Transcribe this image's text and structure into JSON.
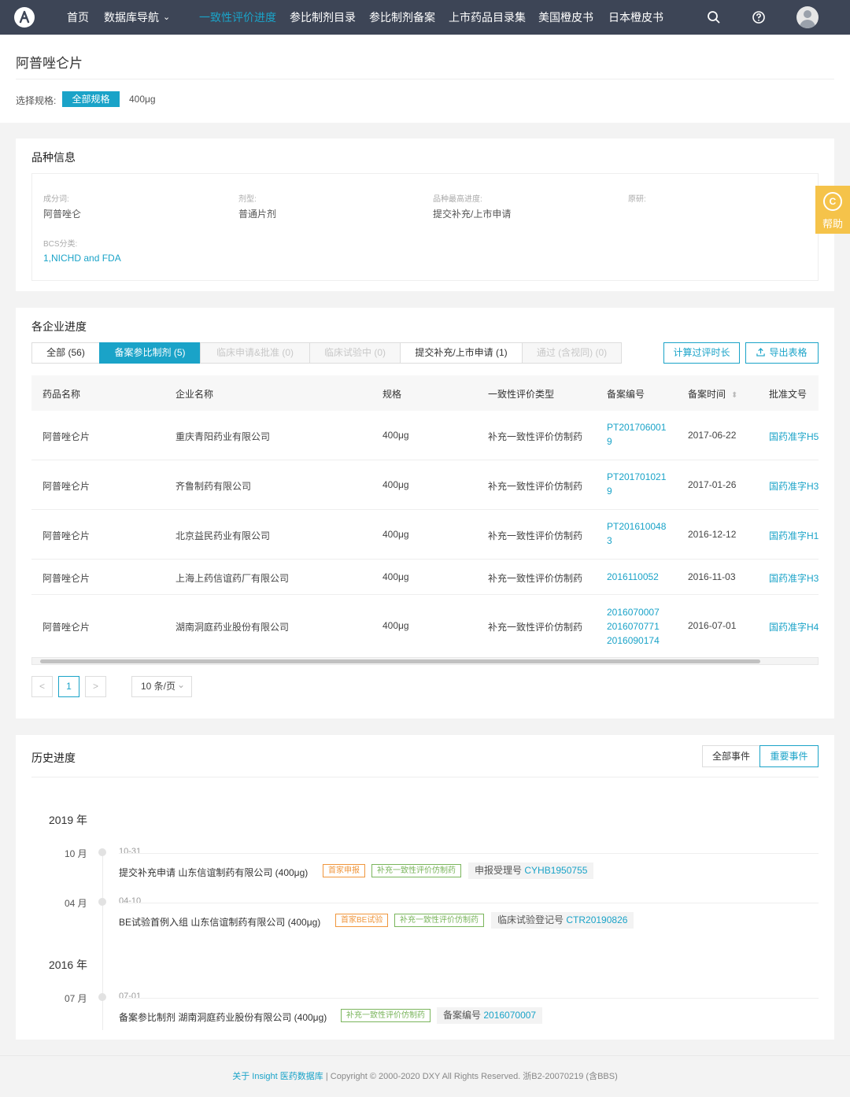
{
  "nav": {
    "items": [
      "首页",
      "数据库导航",
      "一致性评价进度",
      "参比制剂目录",
      "参比制剂备案",
      "上市药品目录集",
      "美国橙皮书",
      "日本橙皮书"
    ],
    "dropdown_caret": "⌄",
    "active_color": "#1aa3c8"
  },
  "page": {
    "title": "阿普唑仑片",
    "spec_label": "选择规格:",
    "spec_all": "全部规格",
    "spec_option": "400μg"
  },
  "variety": {
    "title": "品种信息",
    "fields": [
      {
        "label": "成分词:",
        "value": "阿普唑仑"
      },
      {
        "label": "剂型:",
        "value": "普通片剂"
      },
      {
        "label": "品种最高进度:",
        "value": "提交补充/上市申请"
      },
      {
        "label": "原研:",
        "value": ""
      },
      {
        "label": "BCS分类:",
        "value": "1,NICHD and FDA"
      }
    ]
  },
  "help": {
    "icon": "C",
    "label": "帮助"
  },
  "progress": {
    "title": "各企业进度",
    "tabs": [
      {
        "label": "全部 (56)",
        "state": "normal"
      },
      {
        "label": "备案参比制剂 (5)",
        "state": "active"
      },
      {
        "label": "临床申请&批准 (0)",
        "state": "disabled"
      },
      {
        "label": "临床试验中 (0)",
        "state": "disabled"
      },
      {
        "label": "提交补充/上市申请 (1)",
        "state": "normal"
      },
      {
        "label": "通过 (含视同) (0)",
        "state": "disabled"
      }
    ],
    "btn_calc": "计算过评时长",
    "btn_export": "导出表格",
    "columns": [
      "药品名称",
      "企业名称",
      "规格",
      "一致性评价类型",
      "备案编号",
      "备案时间",
      "批准文号"
    ],
    "sort_icon": "⬍",
    "rows": [
      {
        "drug": "阿普唑仑片",
        "company": "重庆青阳药业有限公司",
        "spec": "400μg",
        "type": "补充一致性评价仿制药",
        "records": [
          "PT201706001",
          "9"
        ],
        "date": "2017-06-22",
        "approval": "国药准字H5"
      },
      {
        "drug": "阿普唑仑片",
        "company": "齐鲁制药有限公司",
        "spec": "400μg",
        "type": "补充一致性评价仿制药",
        "records": [
          "PT201701021",
          "9"
        ],
        "date": "2017-01-26",
        "approval": "国药准字H3"
      },
      {
        "drug": "阿普唑仑片",
        "company": "北京益民药业有限公司",
        "spec": "400μg",
        "type": "补充一致性评价仿制药",
        "records": [
          "PT201610048",
          "3"
        ],
        "date": "2016-12-12",
        "approval": "国药准字H1"
      },
      {
        "drug": "阿普唑仑片",
        "company": "上海上药信谊药厂有限公司",
        "spec": "400μg",
        "type": "补充一致性评价仿制药",
        "records": [
          "2016110052"
        ],
        "date": "2016-11-03",
        "approval": "国药准字H3"
      },
      {
        "drug": "阿普唑仑片",
        "company": "湖南洞庭药业股份有限公司",
        "spec": "400μg",
        "type": "补充一致性评价仿制药",
        "records": [
          "2016070007",
          "2016070771",
          "2016090174"
        ],
        "date": "2016-07-01",
        "approval": "国药准字H4"
      }
    ],
    "pagination": {
      "prev": "<",
      "current": "1",
      "next": ">",
      "page_size": "10 条/页"
    }
  },
  "history": {
    "title": "历史进度",
    "btn_all": "全部事件",
    "btn_important": "重要事件",
    "groups": [
      {
        "year": "2019 年",
        "events": [
          {
            "month": "10 月",
            "date": "10-31",
            "text": "提交补充申请 山东信谊制药有限公司 (400μg)",
            "tags": [
              {
                "t": "首家申报",
                "c": "orange"
              },
              {
                "t": "补充一致性评价仿制药",
                "c": "green"
              }
            ],
            "reg_label": "申报受理号",
            "reg_num": "CYHB1950755"
          },
          {
            "month": "04 月",
            "date": "04-10",
            "text": "BE试验首例入组 山东信谊制药有限公司 (400μg)",
            "tags": [
              {
                "t": "首家BE试验",
                "c": "orange"
              },
              {
                "t": "补充一致性评价仿制药",
                "c": "green"
              }
            ],
            "reg_label": "临床试验登记号",
            "reg_num": "CTR20190826"
          }
        ]
      },
      {
        "year": "2016 年",
        "events": [
          {
            "month": "07 月",
            "date": "07-01",
            "text": "备案参比制剂 湖南洞庭药业股份有限公司 (400μg)",
            "tags": [
              {
                "t": "补充一致性评价仿制药",
                "c": "green"
              }
            ],
            "reg_label": "备案编号",
            "reg_num": "2016070007"
          }
        ]
      }
    ]
  },
  "footer": {
    "link": "关于 Insight 医药数据库",
    "sep": "|",
    "text": "Copyright © 2000-2020 DXY All Rights Reserved. 浙B2-20070219 (含BBS)"
  }
}
